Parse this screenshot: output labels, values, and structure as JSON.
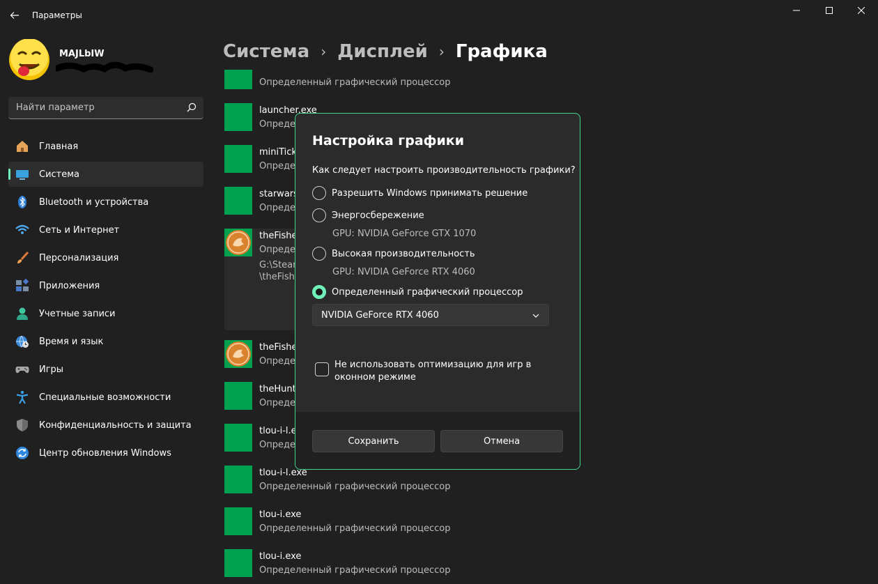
{
  "window": {
    "title": "Параметры"
  },
  "profile": {
    "name": "MAJLbIW"
  },
  "search": {
    "placeholder": "Найти параметр"
  },
  "sidebar": {
    "items": [
      {
        "label": "Главная",
        "icon": "home-icon"
      },
      {
        "label": "Система",
        "icon": "system-display-icon"
      },
      {
        "label": "Bluetooth и устройства",
        "icon": "bluetooth-icon"
      },
      {
        "label": "Сеть и Интернет",
        "icon": "wifi-icon"
      },
      {
        "label": "Персонализация",
        "icon": "brush-icon"
      },
      {
        "label": "Приложения",
        "icon": "apps-icon"
      },
      {
        "label": "Учетные записи",
        "icon": "user-icon"
      },
      {
        "label": "Время и язык",
        "icon": "globe-clock-icon"
      },
      {
        "label": "Игры",
        "icon": "gamepad-icon"
      },
      {
        "label": "Специальные возможности",
        "icon": "accessibility-icon"
      },
      {
        "label": "Конфиденциальность и защита",
        "icon": "shield-icon"
      },
      {
        "label": "Центр обновления Windows",
        "icon": "update-icon"
      }
    ],
    "active_index": 1
  },
  "breadcrumb": {
    "items": [
      "Система",
      "Дисплей",
      "Графика"
    ]
  },
  "apps": [
    {
      "name": "",
      "sub": "Определенный графический процессор"
    },
    {
      "name": "launcher.exe",
      "sub": "Опреде"
    },
    {
      "name": "miniTick",
      "sub": "Опреде"
    },
    {
      "name": "starwars",
      "sub": "Опреде"
    },
    {
      "name": "theFishe",
      "sub": "Опреде",
      "path1": "G:\\Steam",
      "path2": "\\theFishe"
    },
    {
      "name": "theFishe",
      "sub": "Опреде"
    },
    {
      "name": "theHunt",
      "sub": "Опреде"
    },
    {
      "name": "tlou-i-l.e",
      "sub": "Опреде"
    },
    {
      "name": "tlou-i-l.exe",
      "sub": "Определенный графический процессор"
    },
    {
      "name": "tlou-i.exe",
      "sub": "Определенный графический процессор"
    },
    {
      "name": "tlou-i.exe",
      "sub": "Определенный графический процессор"
    }
  ],
  "dialog": {
    "title": "Настройка графики",
    "question": "Как следует настроить производительность графики?",
    "options": [
      {
        "label": "Разрешить Windows принимать решение",
        "checked": false
      },
      {
        "label": "Энергосбережение",
        "gpu": "GPU: NVIDIA GeForce GTX 1070",
        "checked": false
      },
      {
        "label": "Высокая производительность",
        "gpu": "GPU: NVIDIA GeForce RTX 4060",
        "checked": false
      },
      {
        "label": "Определенный графический процессор",
        "checked": true
      }
    ],
    "gpu_select": "NVIDIA GeForce RTX 4060",
    "checkbox_label": "Не использовать оптимизацию для игр в оконном режиме",
    "checkbox_checked": false,
    "save_label": "Сохранить",
    "cancel_label": "Отмена"
  },
  "colors": {
    "accent": "#6ff1b9",
    "dialog_border": "#3ed98e",
    "app_tile": "#00a051",
    "background": "#202020"
  }
}
